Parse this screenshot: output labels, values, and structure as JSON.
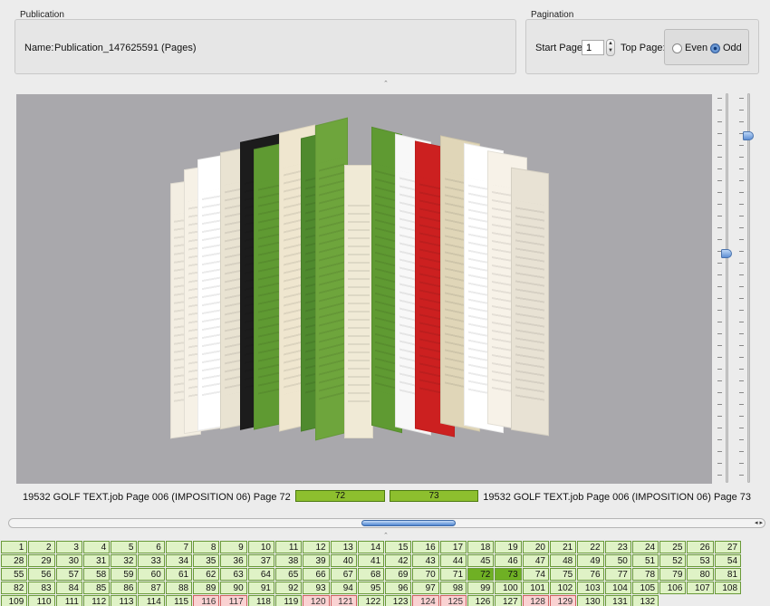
{
  "publication": {
    "group_title": "Publication",
    "name_label": "Name:",
    "name_value": "Publication_147625591 (Pages)"
  },
  "pagination": {
    "group_title": "Pagination",
    "start_label": "Start Page:",
    "start_value": "1",
    "top_label": "Top Page:",
    "even_label": "Even",
    "odd_label": "Odd",
    "selected": "Odd"
  },
  "viewer": {
    "left_caption": "19532 GOLF  TEXT.job Page 006 (IMPOSITION 06) Page 72",
    "right_caption": "19532 GOLF  TEXT.job Page 006 (IMPOSITION 06) Page 73",
    "left_page": "72",
    "right_page": "73"
  },
  "page_grid": {
    "columns": 27,
    "selected": [
      72,
      73
    ],
    "flagged": [
      116,
      117,
      120,
      121,
      124,
      125,
      128,
      129
    ],
    "pages": [
      "1",
      "2",
      "3",
      "4",
      "5",
      "6",
      "7",
      "8",
      "9",
      "10",
      "11",
      "12",
      "13",
      "14",
      "15",
      "16",
      "17",
      "18",
      "19",
      "20",
      "21",
      "22",
      "23",
      "24",
      "25",
      "26",
      "27",
      "28",
      "29",
      "30",
      "31",
      "32",
      "33",
      "34",
      "35",
      "36",
      "37",
      "38",
      "39",
      "40",
      "41",
      "42",
      "43",
      "44",
      "45",
      "46",
      "47",
      "48",
      "49",
      "50",
      "51",
      "52",
      "53",
      "54",
      "55",
      "56",
      "57",
      "58",
      "59",
      "60",
      "61",
      "62",
      "63",
      "64",
      "65",
      "66",
      "67",
      "68",
      "69",
      "70",
      "71",
      "72",
      "73",
      "74",
      "75",
      "76",
      "77",
      "78",
      "79",
      "80",
      "81",
      "82",
      "83",
      "84",
      "85",
      "86",
      "87",
      "88",
      "89",
      "90",
      "91",
      "92",
      "93",
      "94",
      "95",
      "96",
      "97",
      "98",
      "99",
      "100",
      "101",
      "102",
      "103",
      "104",
      "105",
      "106",
      "107",
      "108",
      "109",
      "110",
      "111",
      "112",
      "113",
      "114",
      "115",
      "116",
      "117",
      "118",
      "119",
      "120",
      "121",
      "122",
      "123",
      "124",
      "125",
      "126",
      "127",
      "128",
      "129",
      "130",
      "131",
      "132"
    ]
  },
  "colors": {
    "selected_cell": "#6fb024",
    "normal_cell": "#dff2c6",
    "flagged_cell": "#fad2d2",
    "viewer_background": "#a9a8ac"
  }
}
